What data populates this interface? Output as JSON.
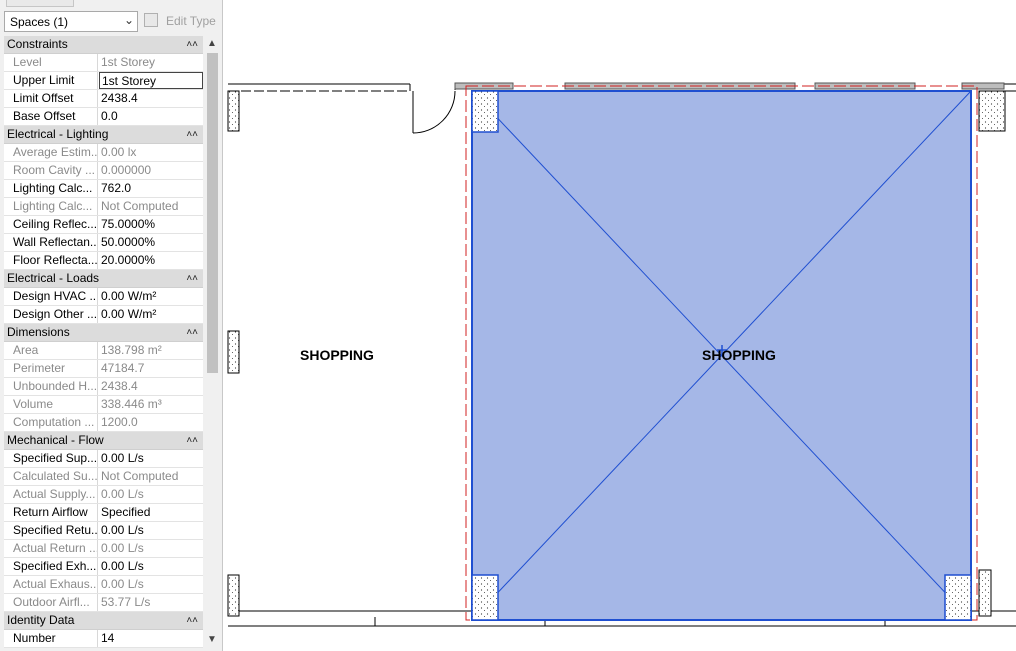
{
  "properties_panel": {
    "type_selector": "Spaces (1)",
    "edit_type_label": "Edit Type",
    "groups": [
      {
        "title": "Constraints",
        "rows": [
          {
            "name": "Level",
            "value": "1st Storey",
            "disabled": true
          },
          {
            "name": "Upper Limit",
            "value": "1st Storey",
            "disabled": false,
            "selected": true
          },
          {
            "name": "Limit Offset",
            "value": "2438.4",
            "disabled": false
          },
          {
            "name": "Base Offset",
            "value": "0.0",
            "disabled": false
          }
        ]
      },
      {
        "title": "Electrical - Lighting",
        "rows": [
          {
            "name": "Average Estim...",
            "value": "0.00 lx",
            "disabled": true
          },
          {
            "name": "Room Cavity ...",
            "value": "0.000000",
            "disabled": true
          },
          {
            "name": "Lighting Calc...",
            "value": "762.0",
            "disabled": false
          },
          {
            "name": "Lighting Calc...",
            "value": "Not Computed",
            "disabled": true
          },
          {
            "name": "Ceiling Reflec...",
            "value": "75.0000%",
            "disabled": false
          },
          {
            "name": "Wall Reflectan...",
            "value": "50.0000%",
            "disabled": false
          },
          {
            "name": "Floor Reflecta...",
            "value": "20.0000%",
            "disabled": false
          }
        ]
      },
      {
        "title": "Electrical - Loads",
        "rows": [
          {
            "name": "Design HVAC ...",
            "value": "0.00 W/m²",
            "disabled": false
          },
          {
            "name": "Design Other ...",
            "value": "0.00 W/m²",
            "disabled": false
          }
        ]
      },
      {
        "title": "Dimensions",
        "rows": [
          {
            "name": "Area",
            "value": "138.798 m²",
            "disabled": true
          },
          {
            "name": "Perimeter",
            "value": "47184.7",
            "disabled": true
          },
          {
            "name": "Unbounded H...",
            "value": "2438.4",
            "disabled": true
          },
          {
            "name": "Volume",
            "value": "338.446 m³",
            "disabled": true
          },
          {
            "name": "Computation ...",
            "value": "1200.0",
            "disabled": true
          }
        ]
      },
      {
        "title": "Mechanical - Flow",
        "rows": [
          {
            "name": "Specified Sup...",
            "value": "0.00 L/s",
            "disabled": false
          },
          {
            "name": "Calculated Su...",
            "value": "Not Computed",
            "disabled": true
          },
          {
            "name": "Actual Supply...",
            "value": "0.00 L/s",
            "disabled": true
          },
          {
            "name": "Return Airflow",
            "value": "Specified",
            "disabled": false
          },
          {
            "name": "Specified Retu...",
            "value": "0.00 L/s",
            "disabled": false
          },
          {
            "name": "Actual Return ...",
            "value": "0.00 L/s",
            "disabled": true
          },
          {
            "name": "Specified Exh...",
            "value": "0.00 L/s",
            "disabled": false
          },
          {
            "name": "Actual Exhaus...",
            "value": "0.00 L/s",
            "disabled": true
          },
          {
            "name": "Outdoor Airfl...",
            "value": "53.77 L/s",
            "disabled": true
          }
        ]
      },
      {
        "title": "Identity Data",
        "rows": [
          {
            "name": "Number",
            "value": "14",
            "disabled": false
          }
        ]
      }
    ]
  },
  "drawing": {
    "room_labels": [
      "SHOPPING",
      "SHOPPING"
    ],
    "space_fill_color": "#a5b7e7",
    "space_outline_color": "#1f4fd1",
    "boundary_dash_color": "#d22020"
  }
}
